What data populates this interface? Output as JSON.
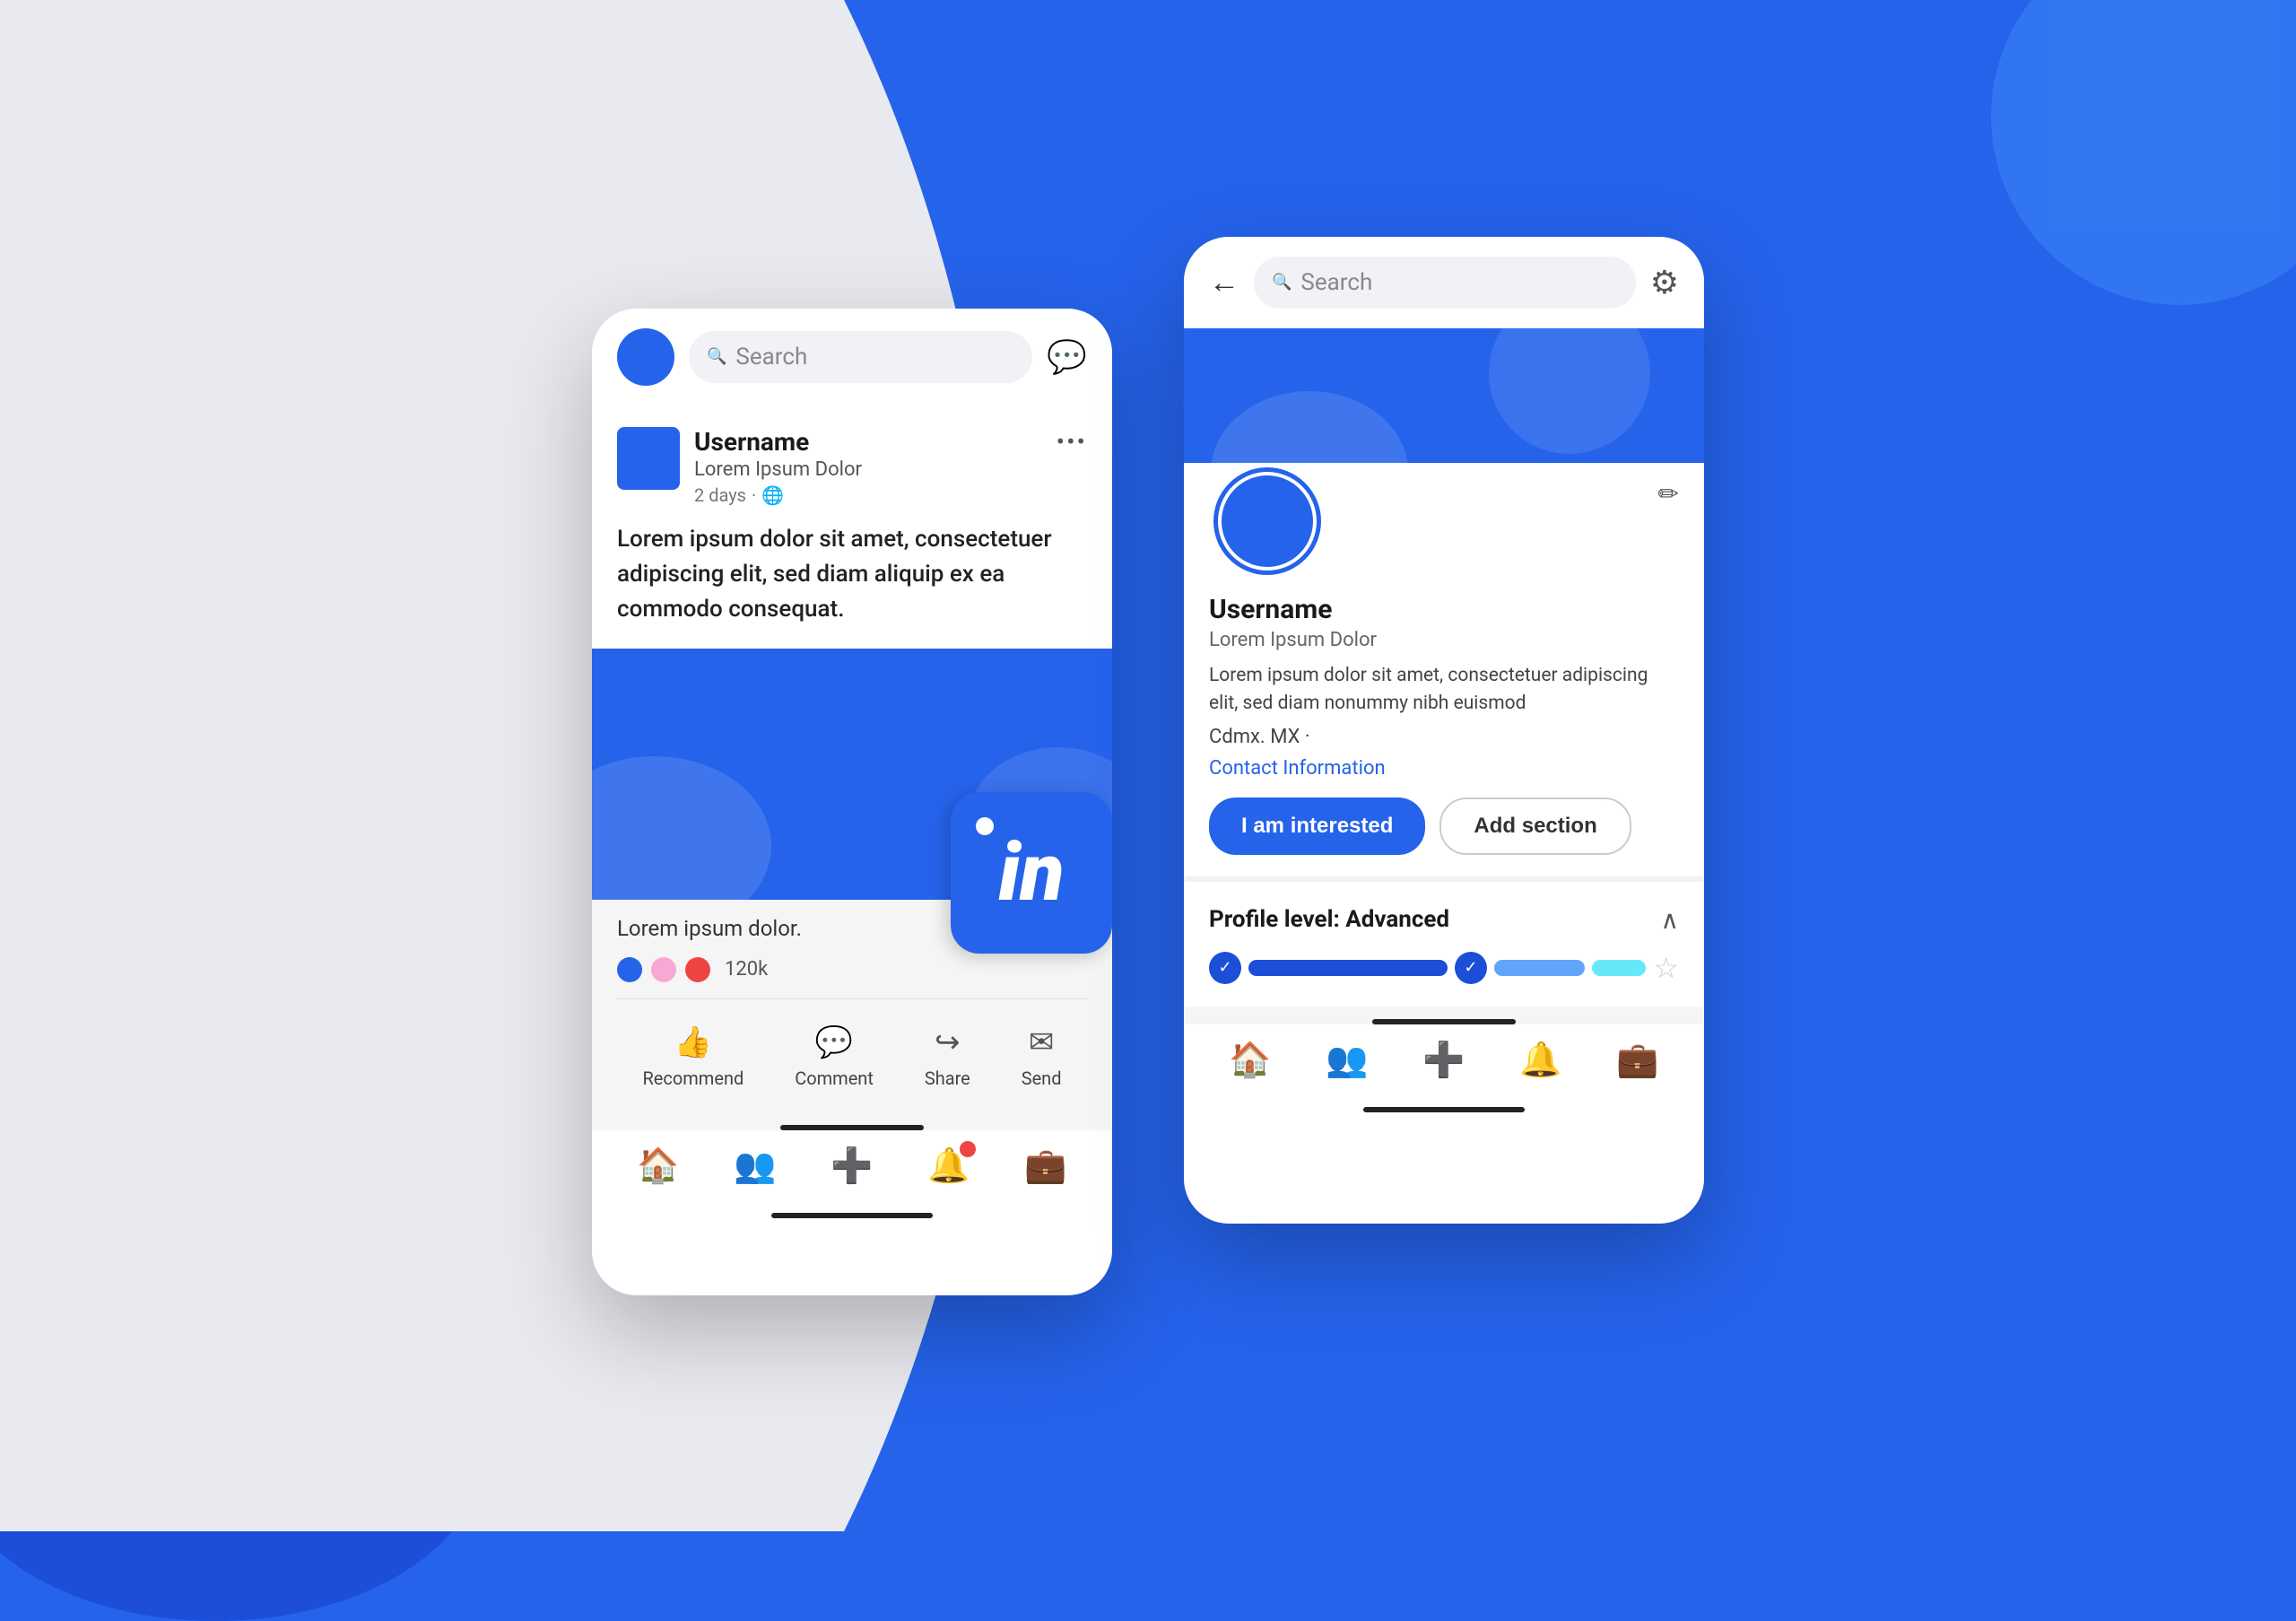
{
  "background": {
    "primary_color": "#2563EB",
    "light_color": "#e8eaf0"
  },
  "left_phone": {
    "top_bar": {
      "search_placeholder": "Search",
      "message_icon": "💬"
    },
    "post": {
      "username": "Username",
      "subtitle": "Lorem Ipsum Dolor",
      "time": "2 days",
      "more_icon": "•••",
      "text": "Lorem ipsum dolor sit amet, consectetuer adipiscing elit, sed diam aliquip ex ea commodo consequat.",
      "caption": "Lorem ipsum dolor.",
      "reactions_count": "120k"
    },
    "actions": [
      {
        "label": "Recommend",
        "icon": "👍"
      },
      {
        "label": "Comment",
        "icon": "💬"
      },
      {
        "label": "Share",
        "icon": "↪"
      },
      {
        "label": "Send",
        "icon": "✉"
      }
    ],
    "bottom_nav": [
      {
        "icon": "🏠",
        "label": "home"
      },
      {
        "icon": "👥",
        "label": "network"
      },
      {
        "icon": "➕",
        "label": "add"
      },
      {
        "icon": "🔔",
        "label": "notifications",
        "badge": true
      },
      {
        "icon": "💼",
        "label": "jobs"
      }
    ]
  },
  "linkedin_logo": {
    "text": "in",
    "dot": true
  },
  "right_phone": {
    "top_bar": {
      "back_label": "←",
      "search_placeholder": "Search",
      "gear_label": "⚙"
    },
    "profile": {
      "username": "Username",
      "subtitle": "Lorem Ipsum Dolor",
      "bio": "Lorem ipsum dolor sit amet, consectetuer adipiscing elit, sed diam nonummy nibh euismod",
      "location": "Cdmx. MX ·",
      "contact_link": "Contact Information",
      "btn_primary": "I am interested",
      "btn_secondary": "Add section"
    },
    "level": {
      "title": "Profile level: Advanced",
      "chevron": "∧"
    },
    "bottom_nav": [
      {
        "icon": "🏠",
        "label": "home"
      },
      {
        "icon": "👥",
        "label": "network"
      },
      {
        "icon": "➕",
        "label": "add"
      },
      {
        "icon": "🔔",
        "label": "notifications"
      },
      {
        "icon": "💼",
        "label": "jobs"
      }
    ]
  },
  "reactions": [
    {
      "color": "#2563EB"
    },
    {
      "color": "#f9a8d4"
    },
    {
      "color": "#ef4444"
    }
  ]
}
